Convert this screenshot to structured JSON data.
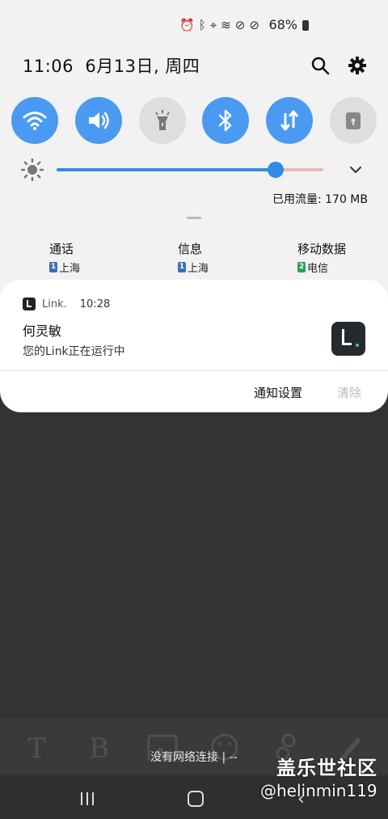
{
  "status_bar": {
    "battery_percent": "68%",
    "icons": [
      "alarm-icon",
      "bluetooth-icon",
      "location-icon",
      "wifi-icon",
      "do-not-disturb-icon",
      "no-sim-icon",
      "battery-icon"
    ]
  },
  "header": {
    "datetime": "11:06  6月13日, 周四",
    "icons": [
      "search-icon",
      "gear-icon"
    ]
  },
  "quick_settings": [
    {
      "name": "wifi",
      "icon": "wifi-icon",
      "state": "on"
    },
    {
      "name": "sound",
      "icon": "speaker-icon",
      "state": "on"
    },
    {
      "name": "flashlight",
      "icon": "flashlight-icon",
      "state": "off"
    },
    {
      "name": "bluetooth",
      "icon": "bluetooth-icon",
      "state": "on"
    },
    {
      "name": "mobile-data",
      "icon": "data-arrows-icon",
      "state": "on"
    },
    {
      "name": "secure-folder",
      "icon": "lock-folder-icon",
      "state": "off"
    }
  ],
  "brightness": {
    "level": 0.82
  },
  "data_usage": "已用流量: 170 MB",
  "sim_row": {
    "call": {
      "label": "通话",
      "sim": "1",
      "carrier": "上海"
    },
    "message": {
      "label": "信息",
      "sim": "1",
      "carrier": "上海"
    },
    "mobile_data": {
      "label": "移动数据",
      "sim": "2",
      "carrier": "电信"
    }
  },
  "notification": {
    "app_name": "Link.",
    "time": "10:28",
    "title": "何灵敏",
    "body": "您的Link正在运行中",
    "action_settings": "通知设置",
    "action_clear": "清除"
  },
  "toolbar_glyphs": {
    "text": "T",
    "bold": "B"
  },
  "toast": "没有网络连接 | --",
  "watermark": {
    "line1": "盖乐世社区",
    "line2": "@helinmin119"
  },
  "colors": {
    "accent": "#4a9af2",
    "shade": "#f2f2f2",
    "background": "#333333",
    "sim1": "#3d6fb8",
    "sim2": "#2e9e5a"
  }
}
